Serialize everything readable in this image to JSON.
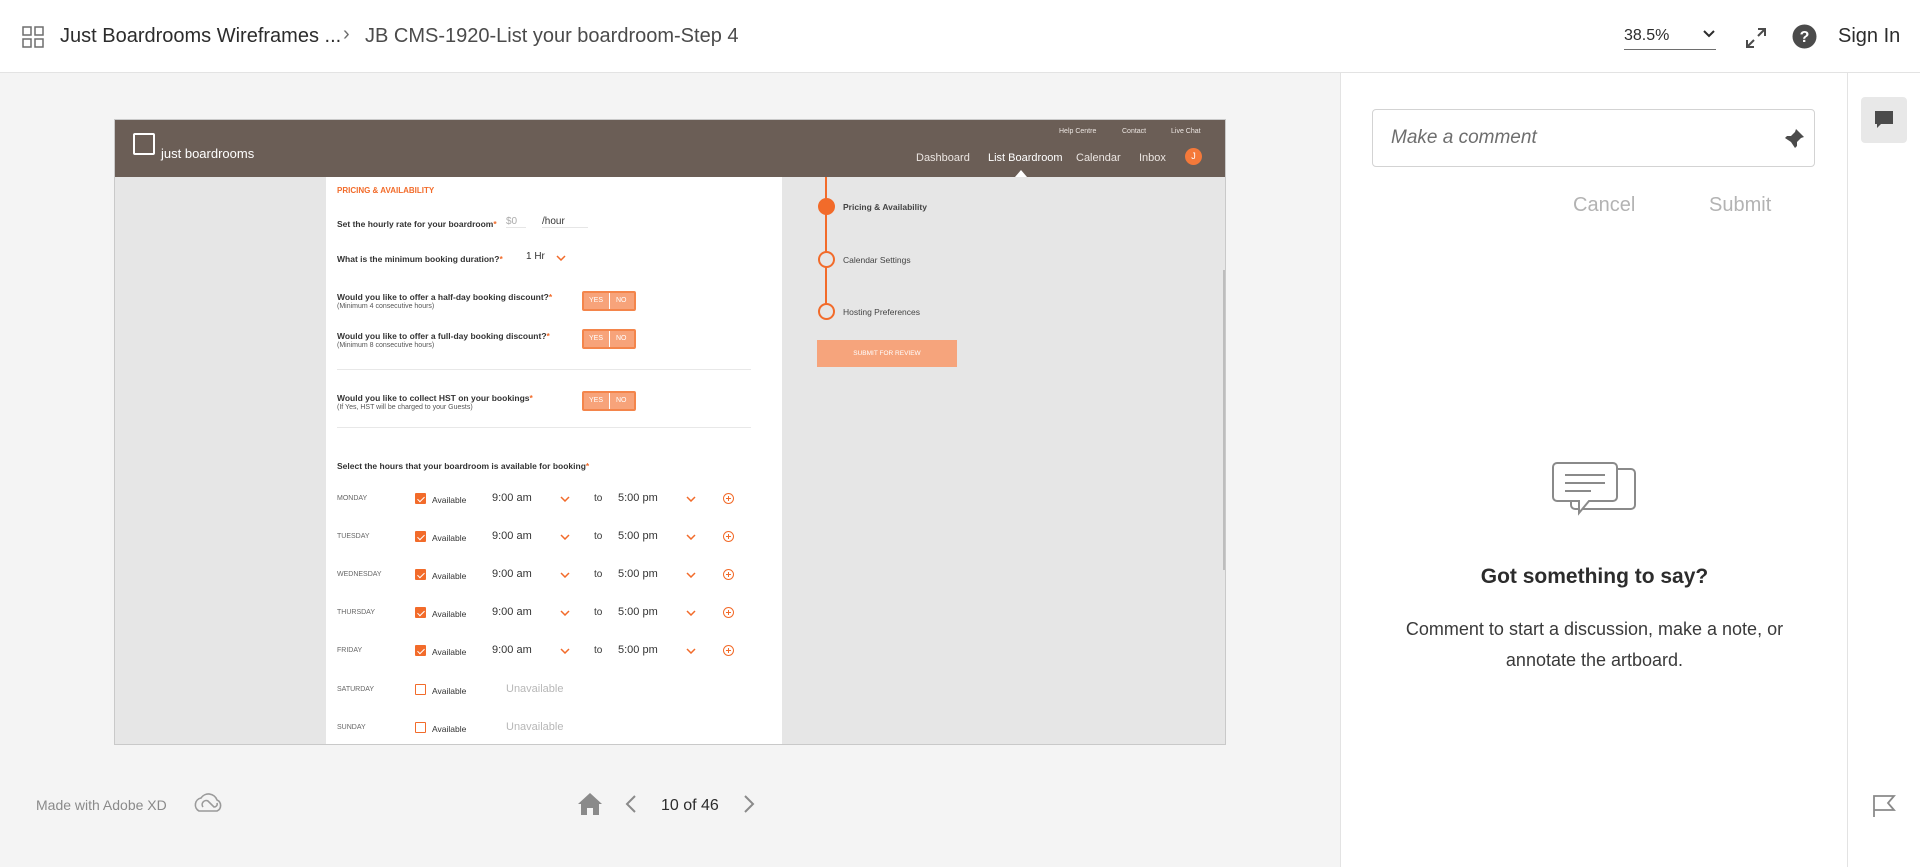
{
  "header": {
    "doc_title": "Just Boardrooms Wireframes ...",
    "artboard_title": "JB CMS-1920-List your boardroom-Step 4",
    "zoom": "38.5%",
    "sign_in": "Sign In"
  },
  "icons": {
    "apps": "apps-grid-icon",
    "fullscreen": "fullscreen-icon",
    "help": "help-icon",
    "pin": "pin-icon",
    "comment": "comment-icon",
    "flag": "flag-icon",
    "home": "home-icon"
  },
  "artboard": {
    "brand": "just boardrooms",
    "top_links": [
      "Help Centre",
      "Contact",
      "Live Chat"
    ],
    "nav": [
      "Dashboard",
      "List Boardroom",
      "Calendar",
      "Inbox"
    ],
    "avatar": "J",
    "section_title": "PRICING & AVAILABILITY",
    "q_rate": "Set the hourly rate for your boardroom",
    "rate_value": "$0",
    "rate_unit": "/hour",
    "q_min": "What is the minimum booking duration?",
    "min_value": "1 Hr",
    "q_half": "Would you like to offer a half-day booking discount?",
    "q_half_sub": "(Minimum 4 consecutive hours)",
    "q_full": "Would you like to offer a full-day booking discount?",
    "q_full_sub": "(Minimum 8 consecutive hours)",
    "q_hst": "Would you like to collect HST on your bookings",
    "q_hst_sub": "(If Yes, HST will be charged to your Guests)",
    "yes": "YES",
    "no": "NO",
    "required": "*",
    "q_hours": "Select the hours that your boardroom is available for booking",
    "available": "Available",
    "to": "to",
    "unavailable": "Unavailable",
    "days": [
      {
        "day": "MONDAY",
        "from": "9:00 am",
        "until": "5:00 pm"
      },
      {
        "day": "TUESDAY",
        "from": "9:00 am",
        "until": "5:00 pm"
      },
      {
        "day": "WEDNESDAY",
        "from": "9:00 am",
        "until": "5:00 pm"
      },
      {
        "day": "THURSDAY",
        "from": "9:00 am",
        "until": "5:00 pm"
      },
      {
        "day": "FRIDAY",
        "from": "9:00 am",
        "until": "5:00 pm"
      },
      {
        "day": "SATURDAY"
      },
      {
        "day": "SUNDAY"
      }
    ],
    "steps": [
      "Pricing & Availability",
      "Calendar Settings",
      "Hosting Preferences"
    ],
    "submit_review": "SUBMIT FOR REVIEW",
    "accent": "#f26b2a",
    "nav_color": "#6b5e56"
  },
  "footer": {
    "made_with": "Made with Adobe XD",
    "page_indicator": "10 of 46"
  },
  "comments": {
    "placeholder": "Make a comment",
    "cancel": "Cancel",
    "submit": "Submit",
    "empty_title": "Got something to say?",
    "empty_text": "Comment to start a discussion, make a note, or annotate the artboard."
  }
}
